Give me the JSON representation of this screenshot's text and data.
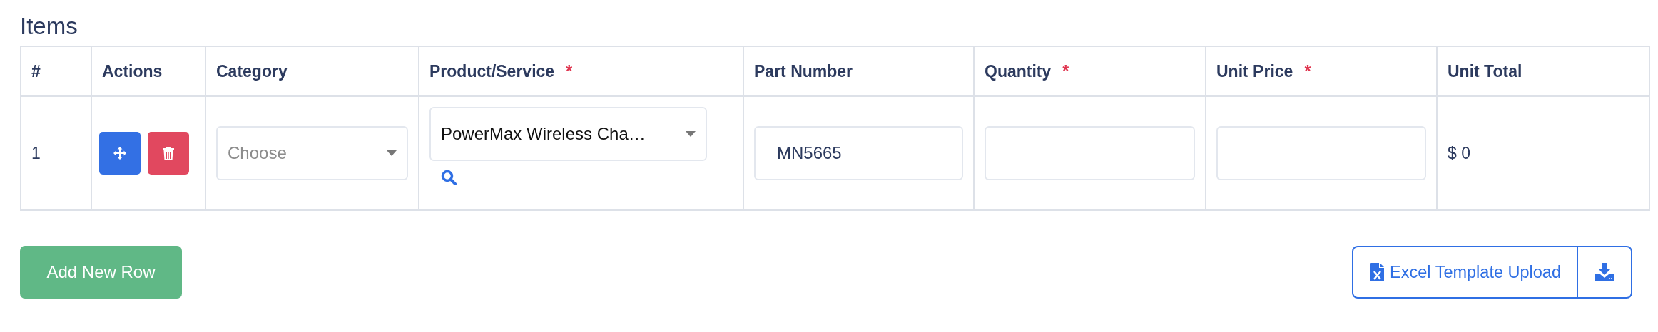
{
  "section_title": "Items",
  "table": {
    "columns": [
      {
        "label": "#"
      },
      {
        "label": "Actions"
      },
      {
        "label": "Category"
      },
      {
        "label": "Product/Service",
        "required_mark": "*"
      },
      {
        "label": "Part Number"
      },
      {
        "label": "Quantity",
        "required_mark": "*"
      },
      {
        "label": "Unit Price",
        "required_mark": "*"
      },
      {
        "label": "Unit Total"
      }
    ],
    "rows": [
      {
        "number": "1",
        "category": {
          "placeholder": "Choose"
        },
        "product": {
          "value": "PowerMax Wireless Cha…"
        },
        "part_number": {
          "value": "MN5665"
        },
        "quantity": {},
        "unit_price": {},
        "unit_total": "$ 0"
      }
    ]
  },
  "add_button": "Add New Row",
  "upload_button": "Excel Template Upload"
}
